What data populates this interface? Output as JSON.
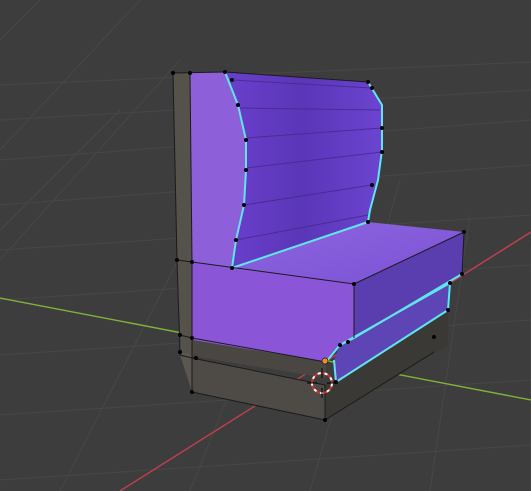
{
  "viewport": {
    "background": "#3d3d3d",
    "grid_color": "#474747",
    "x_axis_color": "#c0404f",
    "y_axis_color": "#7fb33a"
  },
  "object": {
    "name": "booth-seat",
    "base_color": "#8b5cd6",
    "dark_side_color": "#4d4a45",
    "selection_color": "#5fe5f0",
    "vertex_color": "#000000"
  },
  "cursor_3d": {
    "icon": "3d-cursor-icon"
  },
  "origin": {
    "icon": "origin-dot-icon",
    "color": "#f08a2a"
  }
}
